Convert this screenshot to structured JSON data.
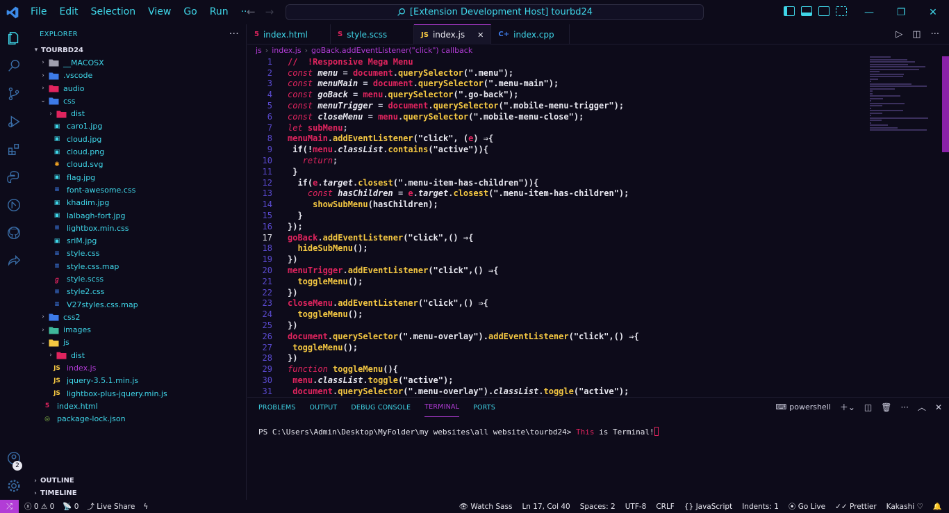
{
  "menu": [
    "File",
    "Edit",
    "Selection",
    "View",
    "Go",
    "Run",
    "···"
  ],
  "command_center": "[Extension Development Host] tourbd24",
  "explorer": {
    "title": "EXPLORER",
    "more": "···",
    "root": "TOURBD24",
    "items": [
      {
        "label": "__MACOSX",
        "type": "folder",
        "open": false,
        "depth": 1,
        "icon_color": "#a0a0b0"
      },
      {
        "label": ".vscode",
        "type": "folder",
        "open": false,
        "depth": 1,
        "icon_color": "#3d7be8"
      },
      {
        "label": "audio",
        "type": "folder",
        "open": false,
        "depth": 1,
        "icon_color": "#e0245e"
      },
      {
        "label": "css",
        "type": "folder",
        "open": true,
        "depth": 1,
        "icon_color": "#3d7be8"
      },
      {
        "label": "dist",
        "type": "folder",
        "open": false,
        "depth": 2,
        "icon_color": "#e0245e"
      },
      {
        "label": "caro1.jpg",
        "type": "image",
        "depth": 2
      },
      {
        "label": "cloud.jpg",
        "type": "image",
        "depth": 2
      },
      {
        "label": "cloud.png",
        "type": "image",
        "depth": 2
      },
      {
        "label": "cloud.svg",
        "type": "svg",
        "depth": 2
      },
      {
        "label": "flag.jpg",
        "type": "image",
        "depth": 2
      },
      {
        "label": "font-awesome.css",
        "type": "css",
        "depth": 2
      },
      {
        "label": "khadim.jpg",
        "type": "image",
        "depth": 2
      },
      {
        "label": "lalbagh-fort.jpg",
        "type": "image",
        "depth": 2
      },
      {
        "label": "lightbox.min.css",
        "type": "css",
        "depth": 2
      },
      {
        "label": "sriM.jpg",
        "type": "image",
        "depth": 2
      },
      {
        "label": "style.css",
        "type": "css",
        "depth": 2
      },
      {
        "label": "style.css.map",
        "type": "css",
        "depth": 2
      },
      {
        "label": "style.scss",
        "type": "scss",
        "depth": 2
      },
      {
        "label": "style2.css",
        "type": "css",
        "depth": 2
      },
      {
        "label": "V27styles.css.map",
        "type": "css",
        "depth": 2
      },
      {
        "label": "css2",
        "type": "folder",
        "open": false,
        "depth": 1,
        "icon_color": "#3d7be8"
      },
      {
        "label": "images",
        "type": "folder",
        "open": false,
        "depth": 1,
        "icon_color": "#3fb89a"
      },
      {
        "label": "js",
        "type": "folder",
        "open": true,
        "depth": 1,
        "icon_color": "#f5c842"
      },
      {
        "label": "dist",
        "type": "folder",
        "open": false,
        "depth": 2,
        "icon_color": "#e0245e"
      },
      {
        "label": "index.js",
        "type": "js",
        "depth": 2,
        "active": true
      },
      {
        "label": "jquery-3.5.1.min.js",
        "type": "js",
        "depth": 2
      },
      {
        "label": "lightbox-plus-jquery.min.js",
        "type": "js",
        "depth": 2
      },
      {
        "label": "index.html",
        "type": "html",
        "depth": 1
      },
      {
        "label": "package-lock.json",
        "type": "json",
        "depth": 1
      }
    ],
    "outline": "OUTLINE",
    "timeline": "TIMELINE"
  },
  "tabs": [
    {
      "label": "index.html",
      "icon": "html-icon",
      "glyph": "5",
      "color": "#e0245e"
    },
    {
      "label": "style.scss",
      "icon": "scss-icon",
      "glyph": "S",
      "color": "#e0245e"
    },
    {
      "label": "index.js",
      "icon": "js-icon",
      "glyph": "JS",
      "color": "#f5c842",
      "active": true,
      "close": "✕"
    },
    {
      "label": "index.cpp",
      "icon": "cpp-icon",
      "glyph": "C+",
      "color": "#3d7be8"
    }
  ],
  "breadcrumb": [
    "js",
    "index.js",
    "goBack.addEventListener(\"click\") callback"
  ],
  "current_line": 17,
  "code": [
    [
      [
        "//  !Responsive Mega Menu",
        "cm"
      ]
    ],
    [
      [
        "const ",
        "kw"
      ],
      [
        "menu",
        "vr"
      ],
      [
        " = ",
        "pu"
      ],
      [
        "document",
        "ob"
      ],
      [
        ".",
        "pu"
      ],
      [
        "querySelector",
        "fn"
      ],
      [
        "(\".menu\");",
        "st"
      ]
    ],
    [
      [
        "const ",
        "kw"
      ],
      [
        "menuMain",
        "vr"
      ],
      [
        " = ",
        "pu"
      ],
      [
        "document",
        "ob"
      ],
      [
        ".",
        "pu"
      ],
      [
        "querySelector",
        "fn"
      ],
      [
        "(\".menu-main\");",
        "st"
      ]
    ],
    [
      [
        "const ",
        "kw"
      ],
      [
        "goBack",
        "vr"
      ],
      [
        " = ",
        "pu"
      ],
      [
        "menu",
        "ob"
      ],
      [
        ".",
        "pu"
      ],
      [
        "querySelector",
        "fn"
      ],
      [
        "(\".go-back\");",
        "st"
      ]
    ],
    [
      [
        "const ",
        "kw"
      ],
      [
        "menuTrigger",
        "vr"
      ],
      [
        " = ",
        "pu"
      ],
      [
        "document",
        "ob"
      ],
      [
        ".",
        "pu"
      ],
      [
        "querySelector",
        "fn"
      ],
      [
        "(\".mobile-menu-trigger\");",
        "st"
      ]
    ],
    [
      [
        "const ",
        "kw"
      ],
      [
        "closeMenu",
        "vr"
      ],
      [
        " = ",
        "pu"
      ],
      [
        "menu",
        "ob"
      ],
      [
        ".",
        "pu"
      ],
      [
        "querySelector",
        "fn"
      ],
      [
        "(\".mobile-menu-close\");",
        "st"
      ]
    ],
    [
      [
        "let ",
        "kw"
      ],
      [
        "subMenu",
        "ob"
      ],
      [
        ";",
        "pu"
      ]
    ],
    [
      [
        "menuMain",
        "ob"
      ],
      [
        ".",
        "pu"
      ],
      [
        "addEventListener",
        "fn"
      ],
      [
        "(\"click\", (",
        "st"
      ],
      [
        "e",
        "ob"
      ],
      [
        ") ⇒{",
        "st"
      ]
    ],
    [
      [
        " if(!",
        "st"
      ],
      [
        "menu",
        "ob"
      ],
      [
        ".",
        "pu"
      ],
      [
        "classList",
        "vr"
      ],
      [
        ".",
        "pu"
      ],
      [
        "contains",
        "fn"
      ],
      [
        "(\"active\")){",
        "st"
      ]
    ],
    [
      [
        "   return",
        "kw"
      ],
      [
        ";",
        "pu"
      ]
    ],
    [
      [
        " }",
        "st"
      ]
    ],
    [
      [
        "  if(",
        "st"
      ],
      [
        "e",
        "ob"
      ],
      [
        ".",
        "pu"
      ],
      [
        "target",
        "vr"
      ],
      [
        ".",
        "pu"
      ],
      [
        "closest",
        "fn"
      ],
      [
        "(\".menu-item-has-children\")){",
        "st"
      ]
    ],
    [
      [
        "    const ",
        "kw"
      ],
      [
        "hasChildren",
        "vr"
      ],
      [
        " = ",
        "pu"
      ],
      [
        "e",
        "ob"
      ],
      [
        ".",
        "pu"
      ],
      [
        "target",
        "vr"
      ],
      [
        ".",
        "pu"
      ],
      [
        "closest",
        "fn"
      ],
      [
        "(\".menu-item-has-children\");",
        "st"
      ]
    ],
    [
      [
        "     showSubMenu",
        "fn"
      ],
      [
        "(hasChildren);",
        "st"
      ]
    ],
    [
      [
        "  }",
        "st"
      ]
    ],
    [
      [
        "});",
        "st"
      ]
    ],
    [
      [
        "goBack",
        "ob"
      ],
      [
        ".",
        "pu"
      ],
      [
        "addEventListener",
        "fn"
      ],
      [
        "(\"click\",() ⇒{",
        "st"
      ]
    ],
    [
      [
        "  hideSubMenu",
        "fn"
      ],
      [
        "();",
        "st"
      ]
    ],
    [
      [
        "})",
        "st"
      ]
    ],
    [
      [
        "menuTrigger",
        "ob"
      ],
      [
        ".",
        "pu"
      ],
      [
        "addEventListener",
        "fn"
      ],
      [
        "(\"click\",() ⇒{",
        "st"
      ]
    ],
    [
      [
        "  toggleMenu",
        "fn"
      ],
      [
        "();",
        "st"
      ]
    ],
    [
      [
        "})",
        "st"
      ]
    ],
    [
      [
        "closeMenu",
        "ob"
      ],
      [
        ".",
        "pu"
      ],
      [
        "addEventListener",
        "fn"
      ],
      [
        "(\"click\",() ⇒{",
        "st"
      ]
    ],
    [
      [
        "  toggleMenu",
        "fn"
      ],
      [
        "();",
        "st"
      ]
    ],
    [
      [
        "})",
        "st"
      ]
    ],
    [
      [
        "document",
        "ob"
      ],
      [
        ".",
        "pu"
      ],
      [
        "querySelector",
        "fn"
      ],
      [
        "(\".menu-overlay\").",
        "st"
      ],
      [
        "addEventListener",
        "fn"
      ],
      [
        "(\"click\",() ⇒{",
        "st"
      ]
    ],
    [
      [
        " toggleMenu",
        "fn"
      ],
      [
        "();",
        "st"
      ]
    ],
    [
      [
        "})",
        "st"
      ]
    ],
    [
      [
        "function ",
        "kw"
      ],
      [
        "toggleMenu",
        "fn"
      ],
      [
        "(){",
        "st"
      ]
    ],
    [
      [
        " menu",
        "ob"
      ],
      [
        ".",
        "pu"
      ],
      [
        "classList",
        "vr"
      ],
      [
        ".",
        "pu"
      ],
      [
        "toggle",
        "fn"
      ],
      [
        "(\"active\");",
        "st"
      ]
    ],
    [
      [
        " document",
        "ob"
      ],
      [
        ".",
        "pu"
      ],
      [
        "querySelector",
        "fn"
      ],
      [
        "(\".menu-overlay\").",
        "st"
      ],
      [
        "classList",
        "vr"
      ],
      [
        ".",
        "pu"
      ],
      [
        "toggle",
        "fn"
      ],
      [
        "(\"active\");",
        "st"
      ]
    ]
  ],
  "panel": {
    "tabs": [
      "PROBLEMS",
      "OUTPUT",
      "DEBUG CONSOLE",
      "TERMINAL",
      "PORTS"
    ],
    "active_tab": "TERMINAL",
    "shell": "powershell",
    "prompt": "PS C:\\Users\\Admin\\Desktop\\MyFolder\\my websites\\all website\\tourbd24> ",
    "cmd_kw": "This",
    "cmd_rest": " is Terminal!"
  },
  "status": {
    "remote": "⤮",
    "errors": "0",
    "warnings": "0",
    "ports": "0",
    "live_share": "Live Share",
    "watch_sass": "Watch Sass",
    "position": "Ln 17, Col 40",
    "spaces": "Spaces: 2",
    "encoding": "UTF-8",
    "eol": "CRLF",
    "language": "JavaScript",
    "indents": "Indents: 1",
    "go_live": "Go Live",
    "prettier": "Prettier",
    "theme": "Kakashi"
  },
  "badge_count": "2"
}
